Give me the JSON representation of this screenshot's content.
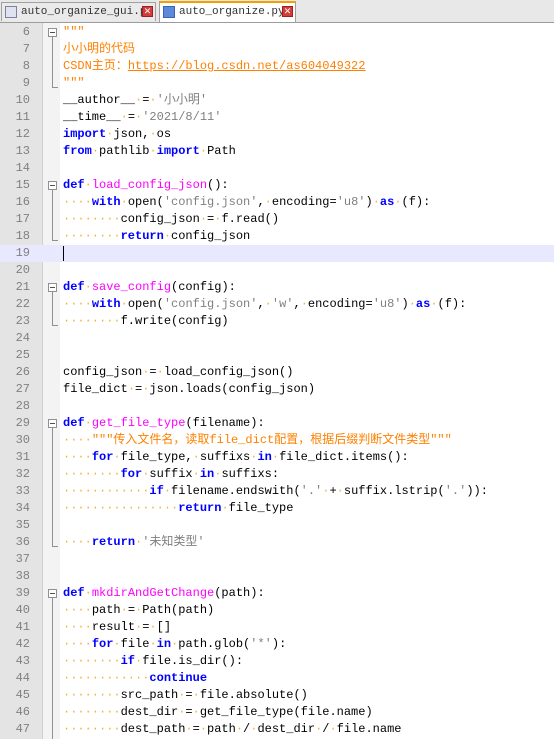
{
  "tabs": [
    {
      "label": "auto_organize_gui.py",
      "close": "✕",
      "active": false
    },
    {
      "label": "auto_organize.py",
      "close": "✕",
      "active": true
    }
  ],
  "editor": {
    "current_line": 19,
    "lines": [
      {
        "n": 6,
        "fold": "start",
        "segs": [
          [
            "d",
            "\"\"\""
          ]
        ]
      },
      {
        "n": 7,
        "segs": [
          [
            "d",
            "小小明的代码"
          ]
        ]
      },
      {
        "n": 8,
        "segs": [
          [
            "d",
            "CSDN主页："
          ],
          [
            "url",
            "https://blog.csdn.net/as604049322"
          ]
        ]
      },
      {
        "n": 9,
        "fold": "end",
        "segs": [
          [
            "d",
            "\"\"\""
          ]
        ]
      },
      {
        "n": 10,
        "segs": [
          [
            "",
            "__author__"
          ],
          [
            "ws",
            "·"
          ],
          [
            "",
            "="
          ],
          [
            "ws",
            "·"
          ],
          [
            "s",
            "'小小明'"
          ]
        ]
      },
      {
        "n": 11,
        "segs": [
          [
            "",
            "__time__"
          ],
          [
            "ws",
            "·"
          ],
          [
            "",
            "="
          ],
          [
            "ws",
            "·"
          ],
          [
            "s",
            "'2021/8/11'"
          ]
        ]
      },
      {
        "n": 12,
        "segs": [
          [
            "k",
            "import"
          ],
          [
            "ws",
            "·"
          ],
          [
            "",
            "json,"
          ],
          [
            "ws",
            "·"
          ],
          [
            "",
            "os"
          ]
        ]
      },
      {
        "n": 13,
        "segs": [
          [
            "k",
            "from"
          ],
          [
            "ws",
            "·"
          ],
          [
            "",
            "pathlib"
          ],
          [
            "ws",
            "·"
          ],
          [
            "k",
            "import"
          ],
          [
            "ws",
            "·"
          ],
          [
            "",
            "Path"
          ]
        ]
      },
      {
        "n": 14,
        "segs": []
      },
      {
        "n": 15,
        "fold": "start",
        "segs": [
          [
            "k",
            "def"
          ],
          [
            "ws",
            "·"
          ],
          [
            "fn",
            "load_config_json"
          ],
          [
            "",
            "():"
          ]
        ]
      },
      {
        "n": 16,
        "segs": [
          [
            "ws",
            "····"
          ],
          [
            "k",
            "with"
          ],
          [
            "ws",
            "·"
          ],
          [
            "",
            "open("
          ],
          [
            "s",
            "'config.json'"
          ],
          [
            "",
            ","
          ],
          [
            "ws",
            "·"
          ],
          [
            "",
            "encoding="
          ],
          [
            "s",
            "'u8'"
          ],
          [
            "",
            ")"
          ],
          [
            "ws",
            "·"
          ],
          [
            "k",
            "as"
          ],
          [
            "ws",
            "·"
          ],
          [
            "",
            "(f):"
          ]
        ]
      },
      {
        "n": 17,
        "segs": [
          [
            "ws",
            "········"
          ],
          [
            "",
            "config_json"
          ],
          [
            "ws",
            "·"
          ],
          [
            "",
            "="
          ],
          [
            "ws",
            "·"
          ],
          [
            "",
            "f.read()"
          ]
        ]
      },
      {
        "n": 18,
        "fold": "end",
        "segs": [
          [
            "ws",
            "········"
          ],
          [
            "k",
            "return"
          ],
          [
            "ws",
            "·"
          ],
          [
            "",
            "config_json"
          ]
        ]
      },
      {
        "n": 19,
        "segs": []
      },
      {
        "n": 20,
        "segs": []
      },
      {
        "n": 21,
        "fold": "start",
        "segs": [
          [
            "k",
            "def"
          ],
          [
            "ws",
            "·"
          ],
          [
            "fn",
            "save_config"
          ],
          [
            "",
            "(config):"
          ]
        ]
      },
      {
        "n": 22,
        "segs": [
          [
            "ws",
            "····"
          ],
          [
            "k",
            "with"
          ],
          [
            "ws",
            "·"
          ],
          [
            "",
            "open("
          ],
          [
            "s",
            "'config.json'"
          ],
          [
            "",
            ","
          ],
          [
            "ws",
            "·"
          ],
          [
            "s",
            "'w'"
          ],
          [
            "",
            ","
          ],
          [
            "ws",
            "·"
          ],
          [
            "",
            "encoding="
          ],
          [
            "s",
            "'u8'"
          ],
          [
            "",
            ")"
          ],
          [
            "ws",
            "·"
          ],
          [
            "k",
            "as"
          ],
          [
            "ws",
            "·"
          ],
          [
            "",
            "(f):"
          ]
        ]
      },
      {
        "n": 23,
        "fold": "end",
        "segs": [
          [
            "ws",
            "········"
          ],
          [
            "",
            "f.write(config)"
          ]
        ]
      },
      {
        "n": 24,
        "segs": []
      },
      {
        "n": 25,
        "segs": []
      },
      {
        "n": 26,
        "segs": [
          [
            "",
            "config_json"
          ],
          [
            "ws",
            "·"
          ],
          [
            "",
            "="
          ],
          [
            "ws",
            "·"
          ],
          [
            "",
            "load_config_json()"
          ]
        ]
      },
      {
        "n": 27,
        "segs": [
          [
            "",
            "file_dict"
          ],
          [
            "ws",
            "·"
          ],
          [
            "",
            "="
          ],
          [
            "ws",
            "·"
          ],
          [
            "",
            "json.loads(config_json)"
          ]
        ]
      },
      {
        "n": 28,
        "segs": []
      },
      {
        "n": 29,
        "fold": "start",
        "segs": [
          [
            "k",
            "def"
          ],
          [
            "ws",
            "·"
          ],
          [
            "fn",
            "get_file_type"
          ],
          [
            "",
            "(filename):"
          ]
        ]
      },
      {
        "n": 30,
        "segs": [
          [
            "ws",
            "····"
          ],
          [
            "d",
            "\"\"\"传入文件名，读取file_dict配置，根据后缀判断文件类型\"\"\""
          ]
        ]
      },
      {
        "n": 31,
        "segs": [
          [
            "ws",
            "····"
          ],
          [
            "k",
            "for"
          ],
          [
            "ws",
            "·"
          ],
          [
            "",
            "file_type,"
          ],
          [
            "ws",
            "·"
          ],
          [
            "",
            "suffixs"
          ],
          [
            "ws",
            "·"
          ],
          [
            "k",
            "in"
          ],
          [
            "ws",
            "·"
          ],
          [
            "",
            "file_dict.items():"
          ]
        ]
      },
      {
        "n": 32,
        "segs": [
          [
            "ws",
            "········"
          ],
          [
            "k",
            "for"
          ],
          [
            "ws",
            "·"
          ],
          [
            "",
            "suffix"
          ],
          [
            "ws",
            "·"
          ],
          [
            "k",
            "in"
          ],
          [
            "ws",
            "·"
          ],
          [
            "",
            "suffixs:"
          ]
        ]
      },
      {
        "n": 33,
        "segs": [
          [
            "ws",
            "············"
          ],
          [
            "k",
            "if"
          ],
          [
            "ws",
            "·"
          ],
          [
            "",
            "filename.endswith("
          ],
          [
            "s",
            "'.'"
          ],
          [
            "ws",
            "·"
          ],
          [
            "",
            "+"
          ],
          [
            "ws",
            "·"
          ],
          [
            "",
            "suffix.lstrip("
          ],
          [
            "s",
            "'.'"
          ],
          [
            "",
            ")):"
          ]
        ]
      },
      {
        "n": 34,
        "segs": [
          [
            "ws",
            "················"
          ],
          [
            "k",
            "return"
          ],
          [
            "ws",
            "·"
          ],
          [
            "",
            "file_type"
          ]
        ]
      },
      {
        "n": 35,
        "segs": []
      },
      {
        "n": 36,
        "fold": "end",
        "segs": [
          [
            "ws",
            "····"
          ],
          [
            "k",
            "return"
          ],
          [
            "ws",
            "·"
          ],
          [
            "s",
            "'未知类型'"
          ]
        ]
      },
      {
        "n": 37,
        "segs": []
      },
      {
        "n": 38,
        "segs": []
      },
      {
        "n": 39,
        "fold": "start",
        "segs": [
          [
            "k",
            "def"
          ],
          [
            "ws",
            "·"
          ],
          [
            "fn",
            "mkdirAndGetChange"
          ],
          [
            "",
            "(path):"
          ]
        ]
      },
      {
        "n": 40,
        "segs": [
          [
            "ws",
            "····"
          ],
          [
            "",
            "path"
          ],
          [
            "ws",
            "·"
          ],
          [
            "",
            "="
          ],
          [
            "ws",
            "·"
          ],
          [
            "",
            "Path(path)"
          ]
        ]
      },
      {
        "n": 41,
        "segs": [
          [
            "ws",
            "····"
          ],
          [
            "",
            "result"
          ],
          [
            "ws",
            "·"
          ],
          [
            "",
            "="
          ],
          [
            "ws",
            "·"
          ],
          [
            "",
            "[]"
          ]
        ]
      },
      {
        "n": 42,
        "segs": [
          [
            "ws",
            "····"
          ],
          [
            "k",
            "for"
          ],
          [
            "ws",
            "·"
          ],
          [
            "",
            "file"
          ],
          [
            "ws",
            "·"
          ],
          [
            "k",
            "in"
          ],
          [
            "ws",
            "·"
          ],
          [
            "",
            "path.glob("
          ],
          [
            "s",
            "'*'"
          ],
          [
            "",
            "):"
          ]
        ]
      },
      {
        "n": 43,
        "segs": [
          [
            "ws",
            "········"
          ],
          [
            "k",
            "if"
          ],
          [
            "ws",
            "·"
          ],
          [
            "",
            "file.is_dir():"
          ]
        ]
      },
      {
        "n": 44,
        "segs": [
          [
            "ws",
            "············"
          ],
          [
            "k",
            "continue"
          ]
        ]
      },
      {
        "n": 45,
        "segs": [
          [
            "ws",
            "········"
          ],
          [
            "",
            "src_path"
          ],
          [
            "ws",
            "·"
          ],
          [
            "",
            "="
          ],
          [
            "ws",
            "·"
          ],
          [
            "",
            "file.absolute()"
          ]
        ]
      },
      {
        "n": 46,
        "segs": [
          [
            "ws",
            "········"
          ],
          [
            "",
            "dest_dir"
          ],
          [
            "ws",
            "·"
          ],
          [
            "",
            "="
          ],
          [
            "ws",
            "·"
          ],
          [
            "",
            "get_file_type(file.name)"
          ]
        ]
      },
      {
        "n": 47,
        "segs": [
          [
            "ws",
            "········"
          ],
          [
            "",
            "dest_path"
          ],
          [
            "ws",
            "·"
          ],
          [
            "",
            "="
          ],
          [
            "ws",
            "·"
          ],
          [
            "",
            "path"
          ],
          [
            "ws",
            "·"
          ],
          [
            "",
            "/"
          ],
          [
            "ws",
            "·"
          ],
          [
            "",
            "dest_dir"
          ],
          [
            "ws",
            "·"
          ],
          [
            "",
            "/"
          ],
          [
            "ws",
            "·"
          ],
          [
            "",
            "file.name"
          ]
        ]
      }
    ]
  }
}
